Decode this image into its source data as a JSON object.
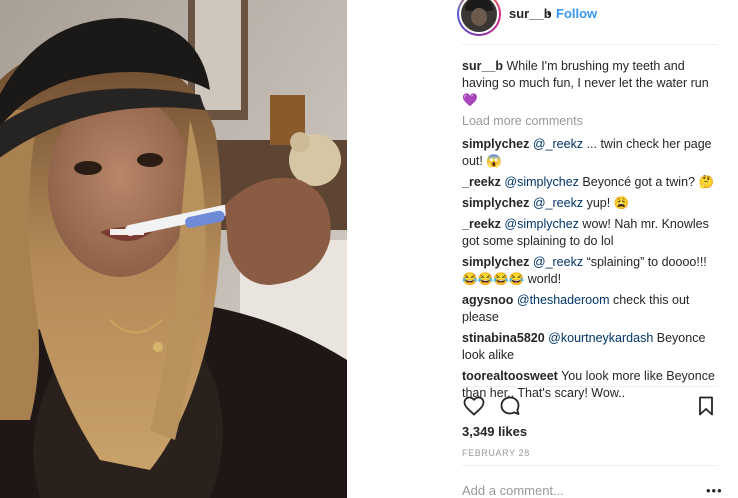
{
  "post": {
    "username": "sur__b",
    "separator": "•",
    "follow_label": "Follow",
    "caption": {
      "username": "sur__b",
      "text": "While I'm brushing my teeth and having so much fun, I never let the water run 💜"
    },
    "load_more_label": "Load more comments",
    "comments": [
      {
        "user": "simplychez",
        "mention": "@_reekz",
        "text": " ... twin check her page out! 😱"
      },
      {
        "user": "_reekz",
        "mention": "@simplychez",
        "text": " Beyoncé got a twin? 🤔"
      },
      {
        "user": "simplychez",
        "mention": "@_reekz",
        "text": " yup! 😩"
      },
      {
        "user": "_reekz",
        "mention": "@simplychez",
        "text": " wow! Nah mr. Knowles got some splaining to do lol"
      },
      {
        "user": "simplychez",
        "mention": "@_reekz",
        "text": " “splaining” to doooo!!! 😂😂😂😂 world!"
      },
      {
        "user": "agysnoo",
        "mention": "@theshaderoom",
        "text": " check this out please"
      },
      {
        "user": "stinabina5820",
        "mention": "@kourtneykardash",
        "text": " Beyonce look alike"
      },
      {
        "user": "toorealtoosweet",
        "mention": "",
        "text": "You look more like Beyonce than her.. That's scary! Wow.."
      }
    ],
    "likes": "3,349 likes",
    "date": "FEBRUARY 28",
    "add_comment_placeholder": "Add a comment...",
    "more_label": "•••",
    "icons": {
      "like": "heart-icon",
      "comment": "comment-bubble-icon",
      "save": "bookmark-icon"
    }
  }
}
